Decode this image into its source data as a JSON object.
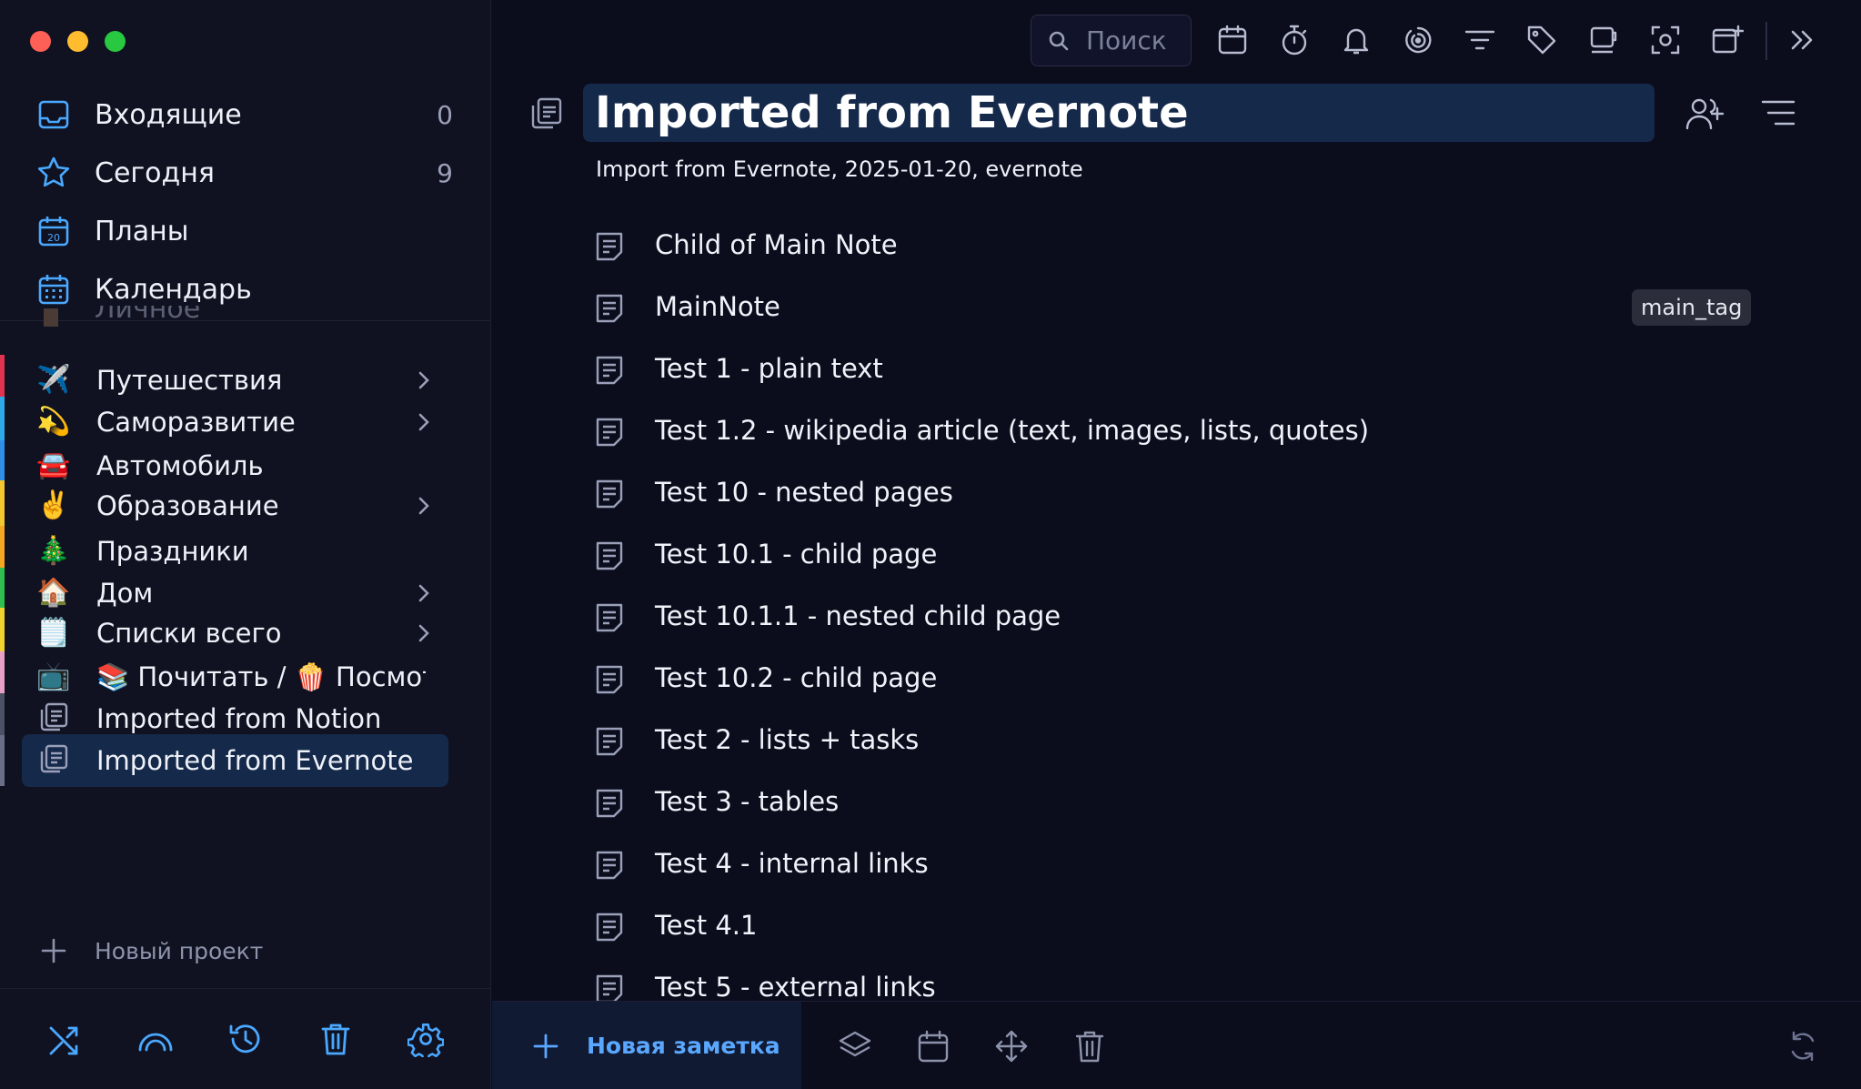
{
  "sidebar": {
    "smart": [
      {
        "label": "Входящие",
        "count": "0",
        "icon": "inbox-icon"
      },
      {
        "label": "Сегодня",
        "count": "9",
        "icon": "star-icon"
      },
      {
        "label": "Планы",
        "count": "",
        "icon": "calendar-20-icon"
      },
      {
        "label": "Календарь",
        "count": "",
        "icon": "calendar-grid-icon"
      }
    ],
    "ghost_label": "Личное",
    "projects": [
      {
        "label": "Путешествия",
        "emoji": "✈️",
        "color": "#e0334f",
        "has_children": true
      },
      {
        "label": "Саморазвитие",
        "emoji": "💫",
        "color": "#2fa8e8",
        "has_children": true
      },
      {
        "label": "Автомобиль",
        "emoji": "🚘",
        "color": "#2f8fe8",
        "has_children": false
      },
      {
        "label": "Образование",
        "emoji": "✌️",
        "color": "#f2c72f",
        "has_children": true
      },
      {
        "label": "Праздники",
        "emoji": "🎄",
        "color": "#f5a623",
        "has_children": false
      },
      {
        "label": "Дом",
        "emoji": "🏠",
        "color": "#2fbf4f",
        "has_children": true
      },
      {
        "label": "Списки всего",
        "emoji": "🗒️",
        "color": "#f2d22f",
        "has_children": true
      },
      {
        "label": "📚 Почитать / 🍿 Посмотреть",
        "emoji": "📺",
        "color": "#e8a0c8",
        "has_children": false
      },
      {
        "label": "Imported from Notion",
        "emoji": "",
        "color": "#4d5166",
        "has_children": false
      },
      {
        "label": "Imported from Evernote",
        "emoji": "",
        "color": "#6a6f86",
        "has_children": false
      }
    ],
    "new_project": "Новый проект"
  },
  "toolbar": {
    "search_placeholder": "Поиск"
  },
  "project": {
    "title": "Imported from Evernote",
    "subtitle": "Import from Evernote, 2025-01-20, evernote"
  },
  "notes": [
    {
      "title": "Child of Main Note",
      "tag": ""
    },
    {
      "title": "MainNote",
      "tag": "main_tag"
    },
    {
      "title": "Test 1 - plain text",
      "tag": ""
    },
    {
      "title": "Test 1.2 - wikipedia article (text, images, lists, quotes)",
      "tag": ""
    },
    {
      "title": "Test 10 - nested pages",
      "tag": ""
    },
    {
      "title": "Test 10.1 - child page",
      "tag": ""
    },
    {
      "title": "Test 10.1.1 - nested child page",
      "tag": ""
    },
    {
      "title": "Test 10.2 - child page",
      "tag": ""
    },
    {
      "title": "Test 2 - lists + tasks",
      "tag": ""
    },
    {
      "title": "Test 3 - tables",
      "tag": ""
    },
    {
      "title": "Test 4 - internal links",
      "tag": ""
    },
    {
      "title": "Test 4.1",
      "tag": ""
    },
    {
      "title": "Test 5 - external links",
      "tag": ""
    }
  ],
  "bottom": {
    "new_note": "Новая заметка"
  },
  "colors": {
    "accent": "#5aa7ff",
    "selection": "#15294a",
    "background": "#0b0d1d",
    "sidebar": "#101221"
  }
}
